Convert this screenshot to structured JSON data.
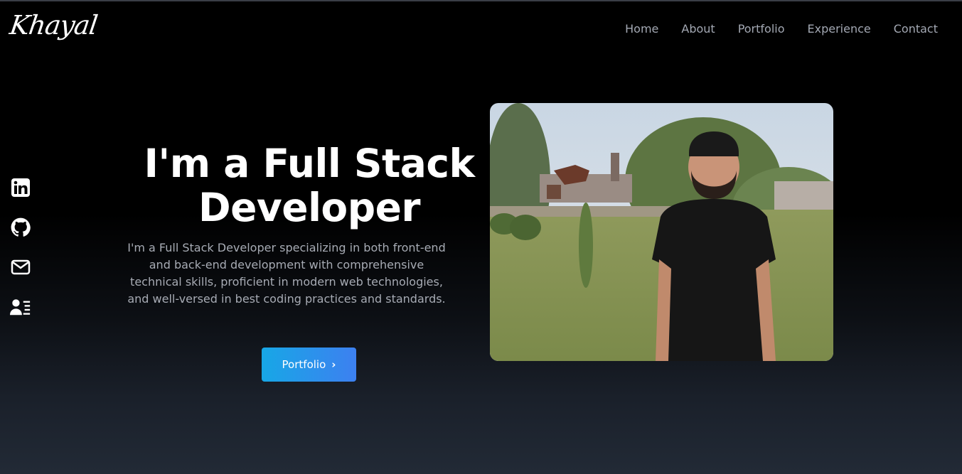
{
  "header": {
    "logo": "Khayal",
    "nav": [
      "Home",
      "About",
      "Portfolio",
      "Experience",
      "Contact"
    ]
  },
  "social": {
    "icons": [
      "linkedin-icon",
      "github-icon",
      "mail-icon",
      "resume-icon"
    ]
  },
  "hero": {
    "title": "I'm a Full Stack Developer",
    "description": "I'm a Full Stack Developer specializing in both front-end and back-end development with comprehensive technical skills, proficient in modern web technologies, and well-versed in best coding practices and standards.",
    "button_label": "Portfolio",
    "button_icon": "chevron-right-icon"
  },
  "colors": {
    "background": "#000000",
    "accent_start": "#17a7e6",
    "accent_end": "#3d80f0",
    "nav_text": "#a3a8b3"
  }
}
